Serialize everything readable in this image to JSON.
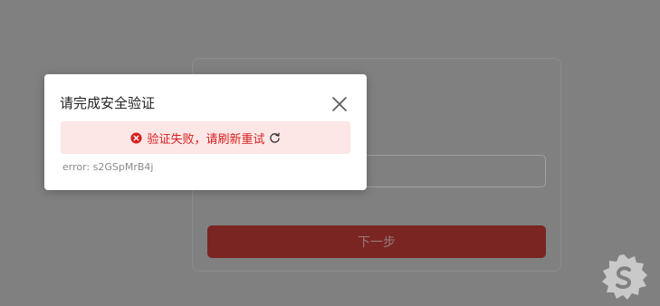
{
  "background": {
    "next_button_label": "下一步"
  },
  "dialog": {
    "title": "请完成安全验证",
    "error_message": "验证失败，请刷新重试",
    "error_code": "error: s2GSpMrB4j"
  },
  "icons": {
    "close": "close-icon",
    "error": "error-circle-icon",
    "refresh": "refresh-icon",
    "watermark": "watermark-logo"
  },
  "colors": {
    "overlay": "#808080",
    "error_text": "#d6201e",
    "error_bg": "#fde6e6",
    "next_button": "#7a2522"
  }
}
